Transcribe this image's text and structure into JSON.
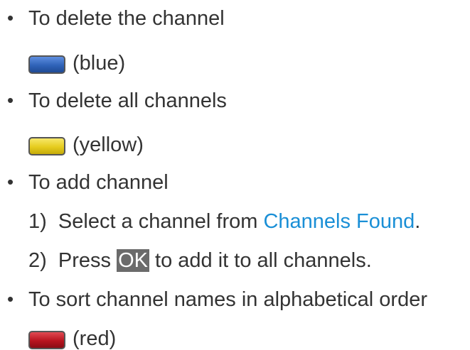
{
  "items": [
    {
      "bullet": "•",
      "text": "To delete the channel"
    },
    {
      "bullet": "•",
      "text": "To delete all channels"
    },
    {
      "bullet": "•",
      "text": "To add channel"
    },
    {
      "bullet": "•",
      "text": "To sort channel names in alphabetical order"
    }
  ],
  "keys": {
    "blue": {
      "label": "(blue)",
      "color": "#2f63b8"
    },
    "yellow": {
      "label": "(yellow)",
      "color": "#e6cc1e"
    },
    "red": {
      "label": "(red)",
      "color": "#b8141f"
    }
  },
  "steps": {
    "step1": {
      "prefix": "1)  Select a channel from ",
      "link": "Channels Found",
      "suffix": "."
    },
    "step2": {
      "prefix": "2)  Press ",
      "ok": "OK",
      "suffix": " to add it to all channels."
    }
  }
}
